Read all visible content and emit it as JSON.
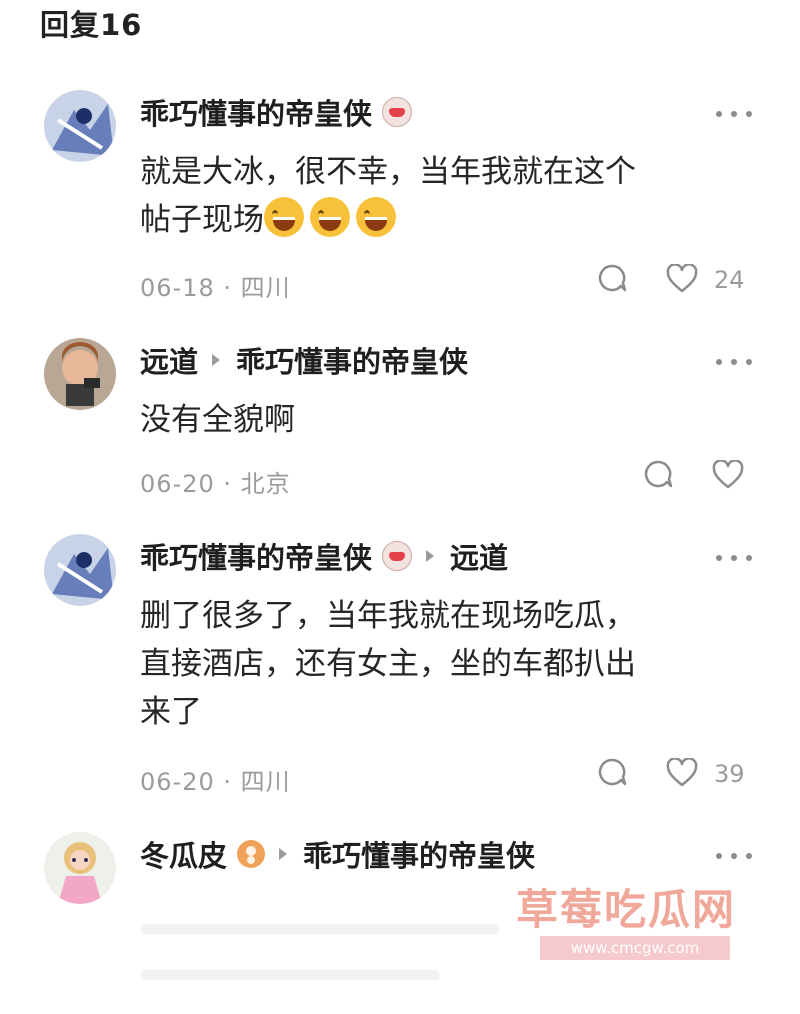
{
  "header": {
    "title": "回复16"
  },
  "comments": [
    {
      "author": "乖巧懂事的帝皇侠",
      "text_line1": "就是大冰，很不幸，当年我就在这个",
      "text_line2": "帖子现场",
      "date_location": "06-18 · 四川",
      "likes": "24"
    },
    {
      "author": "远道",
      "reply_to": "乖巧懂事的帝皇侠",
      "text_line1": "没有全貌啊",
      "date_location": "06-20 · 北京",
      "likes": ""
    },
    {
      "author": "乖巧懂事的帝皇侠",
      "reply_to": "远道",
      "text_line1": "删了很多了，当年我就在现场吃瓜，",
      "text_line2": "直接酒店，还有女主，坐的车都扒出",
      "text_line3": "来了",
      "date_location": "06-20 · 四川",
      "likes": "39"
    },
    {
      "author": "冬瓜皮",
      "reply_to": "乖巧懂事的帝皇侠"
    }
  ],
  "watermark": {
    "text": "草莓吃瓜网",
    "url": "www.cmcgw.com"
  },
  "colors": {
    "text": "#1f1f1f",
    "meta": "#9b9b9b",
    "icon": "#8b8b8b"
  }
}
